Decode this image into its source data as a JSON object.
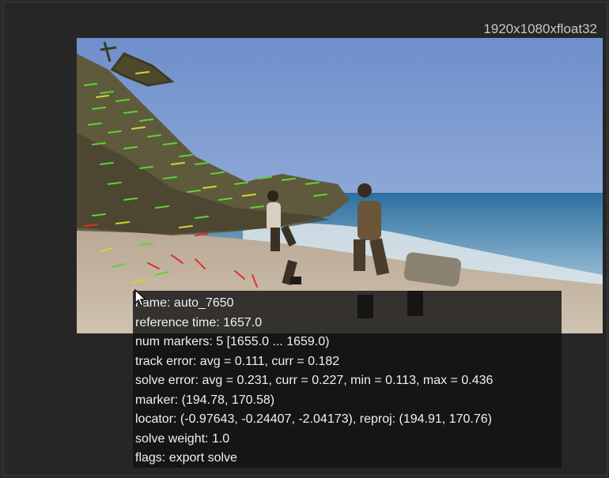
{
  "viewer": {
    "resolution_label": "1920x1080xfloat32"
  },
  "colors": {
    "track_good": "#5fd23a",
    "track_mid": "#d8d23a",
    "track_bad": "#e0302a",
    "panel_bg": "#121212",
    "text": "#f0f0f0"
  },
  "info_panel": {
    "lines": [
      "name: auto_7650",
      "reference time: 1657.0",
      "num markers: 5 [1655.0 ... 1659.0)",
      "track error: avg = 0.111, curr = 0.182",
      "solve error: avg = 0.231, curr = 0.227, min = 0.113, max = 0.436",
      "marker: (194.78, 170.58)",
      "locator: (-0.97643, -0.24407, -2.04173), reproj: (194.91, 170.76)",
      "solve weight: 1.0",
      "flags: export solve"
    ]
  },
  "icons": {
    "cursor": "arrow-cursor-icon"
  }
}
